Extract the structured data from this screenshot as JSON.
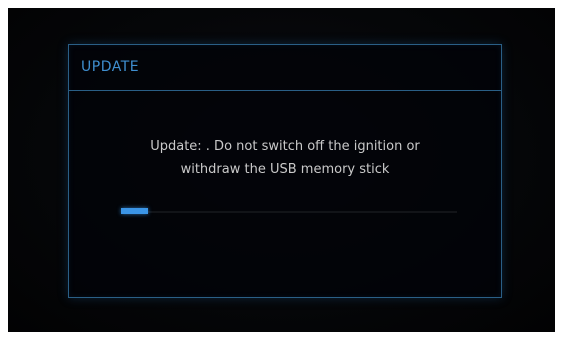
{
  "dialog": {
    "title": "UPDATE",
    "message_line1": "Update: . Do not switch off the ignition or",
    "message_line2": "withdraw the USB memory stick"
  },
  "progress": {
    "fraction": 0.08,
    "color": "#3b95e6"
  },
  "colors": {
    "background": "#050608",
    "accent": "#3f8fd0",
    "border": "#2a5f86",
    "text": "#c9c9c9"
  }
}
